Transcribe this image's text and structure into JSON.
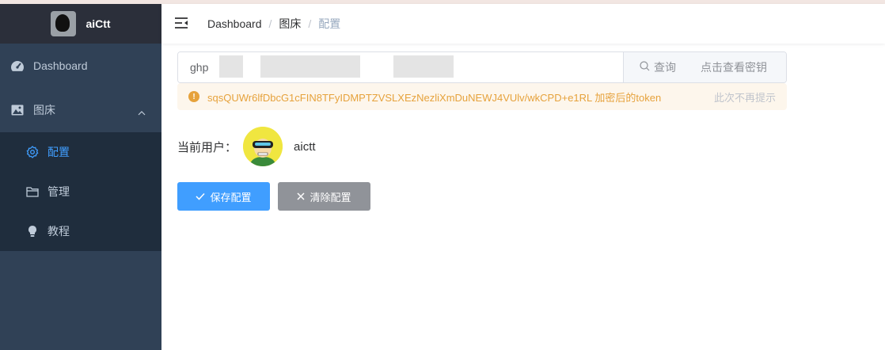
{
  "app": {
    "title": "aiCtt"
  },
  "sidebar": {
    "items": [
      {
        "label": "Dashboard",
        "icon": "dashboard-icon"
      },
      {
        "label": "图床",
        "icon": "image-icon",
        "expanded": true,
        "children": [
          {
            "label": "配置",
            "icon": "gear-icon",
            "active": true
          },
          {
            "label": "管理",
            "icon": "folder-icon"
          },
          {
            "label": "教程",
            "icon": "bulb-icon"
          }
        ]
      }
    ]
  },
  "breadcrumb": [
    "Dashboard",
    "图床",
    "配置"
  ],
  "token": {
    "value": "ghp",
    "query_label": "查询",
    "view_key_label": "点击查看密钥"
  },
  "alert": {
    "message": "sqsQUWr6lfDbcG1cFIN8TFyIDMPTZVSLXEzNezliXmDuNEWJ4VUlv/wkCPD+e1RL 加密后的token",
    "close_label": "此次不再提示",
    "type": "warning"
  },
  "user": {
    "label": "当前用户：",
    "name": "aictt"
  },
  "actions": {
    "save_label": "保存配置",
    "clear_label": "清除配置"
  },
  "colors": {
    "primary": "#409eff",
    "info": "#909399",
    "warning": "#e6a23c",
    "sidebar_bg": "#304156"
  }
}
